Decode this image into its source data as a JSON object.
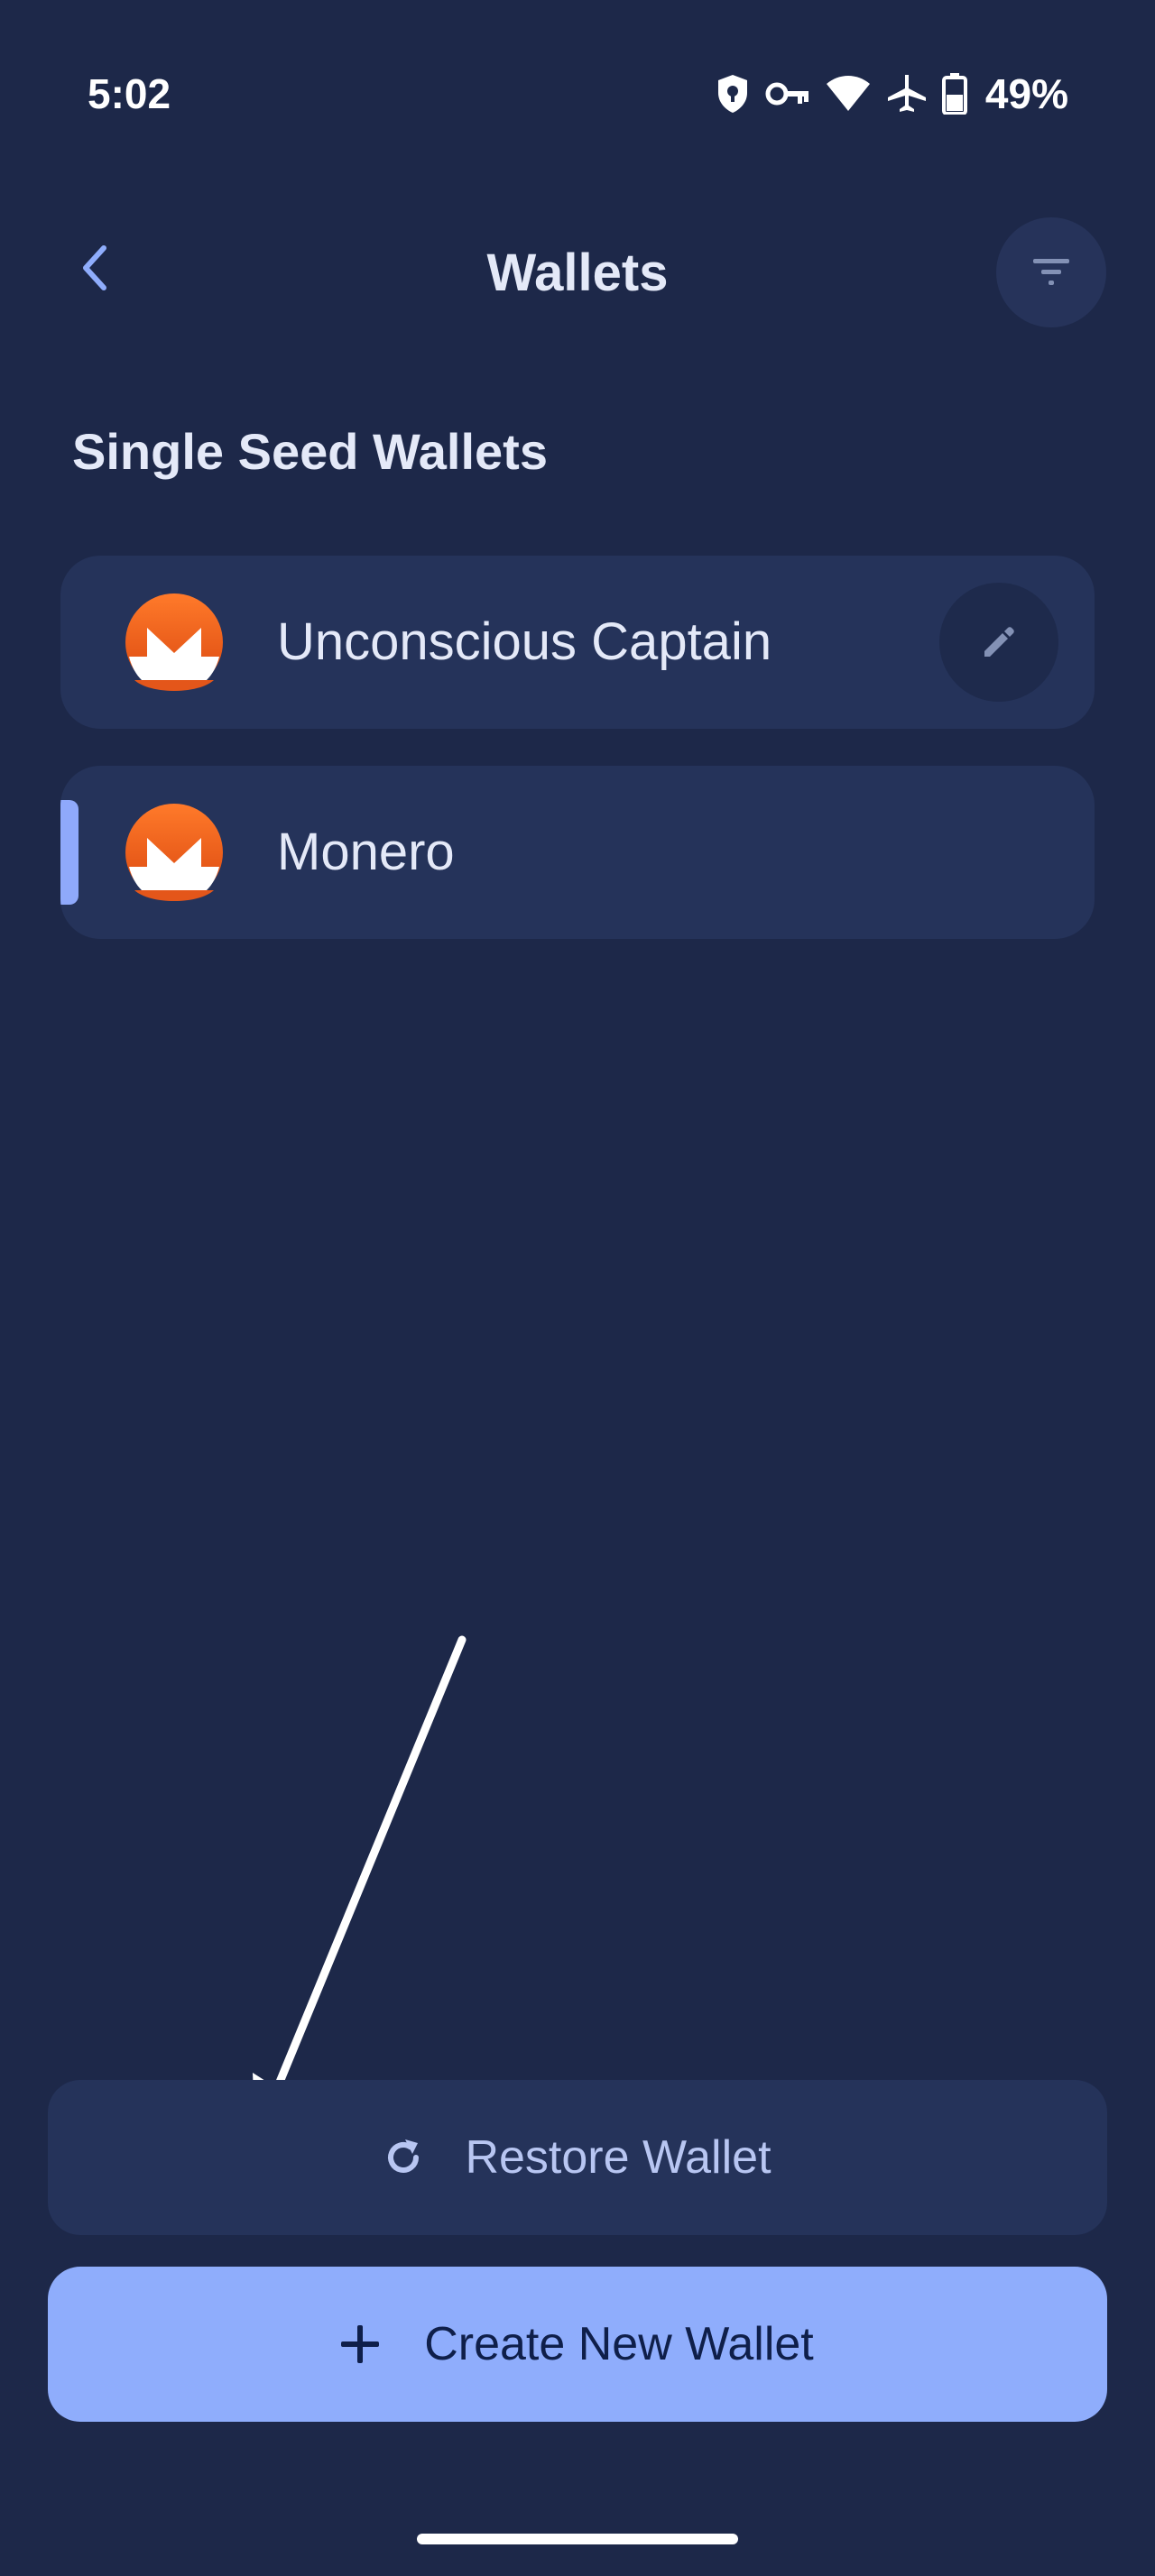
{
  "status_bar": {
    "time": "5:02",
    "icons": [
      "vpn-shield-icon",
      "key-icon",
      "wifi-icon",
      "airplane-icon",
      "battery-icon"
    ],
    "battery_percent": "49%"
  },
  "header": {
    "title": "Wallets",
    "back_icon": "chevron-left-icon",
    "filter_icon": "filter-icon"
  },
  "section": {
    "title": "Single Seed Wallets"
  },
  "wallets": [
    {
      "name": "Unconscious Captain",
      "coin_icon": "monero-icon",
      "action_icon": "pencil-icon",
      "selected": false
    },
    {
      "name": "Monero",
      "coin_icon": "monero-icon",
      "selected": true
    }
  ],
  "actions": {
    "restore_label": "Restore Wallet",
    "restore_icon": "refresh-icon",
    "create_label": "Create New Wallet",
    "create_icon": "plus-icon"
  },
  "colors": {
    "background": "#1D2849",
    "card": "#25335A",
    "accent": "#8FADFC",
    "monero_orange": "#F26822"
  }
}
